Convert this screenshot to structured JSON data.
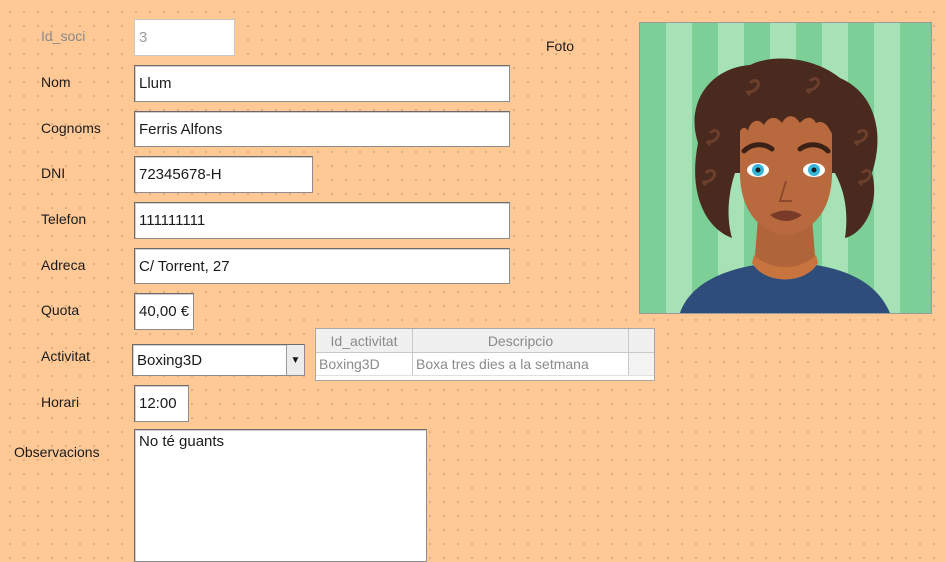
{
  "labels": {
    "id_soci": "Id_soci",
    "nom": "Nom",
    "cognoms": "Cognoms",
    "dni": "DNI",
    "telefon": "Telefon",
    "adreca": "Adreca",
    "quota": "Quota",
    "activitat": "Activitat",
    "horari": "Horari",
    "observacions": "Observacions",
    "foto": "Foto"
  },
  "fields": {
    "id_soci": "3",
    "nom": "Llum",
    "cognoms": "Ferris Alfons",
    "dni": "72345678-H",
    "telefon": "111111111",
    "adreca": "C/ Torrent, 27",
    "quota": "40,00 €",
    "activitat": "Boxing3D",
    "horari": "12:00",
    "observacions": "No té guants"
  },
  "grid": {
    "columns": [
      "Id_activitat",
      "Descripcio"
    ],
    "rows": [
      [
        "Boxing3D",
        "Boxa tres dies a la setmana"
      ]
    ]
  },
  "icons": {
    "dropdown": "chevron-down-icon"
  },
  "colors": {
    "background": "#ffc895",
    "photo_background": "#7ccf96"
  }
}
